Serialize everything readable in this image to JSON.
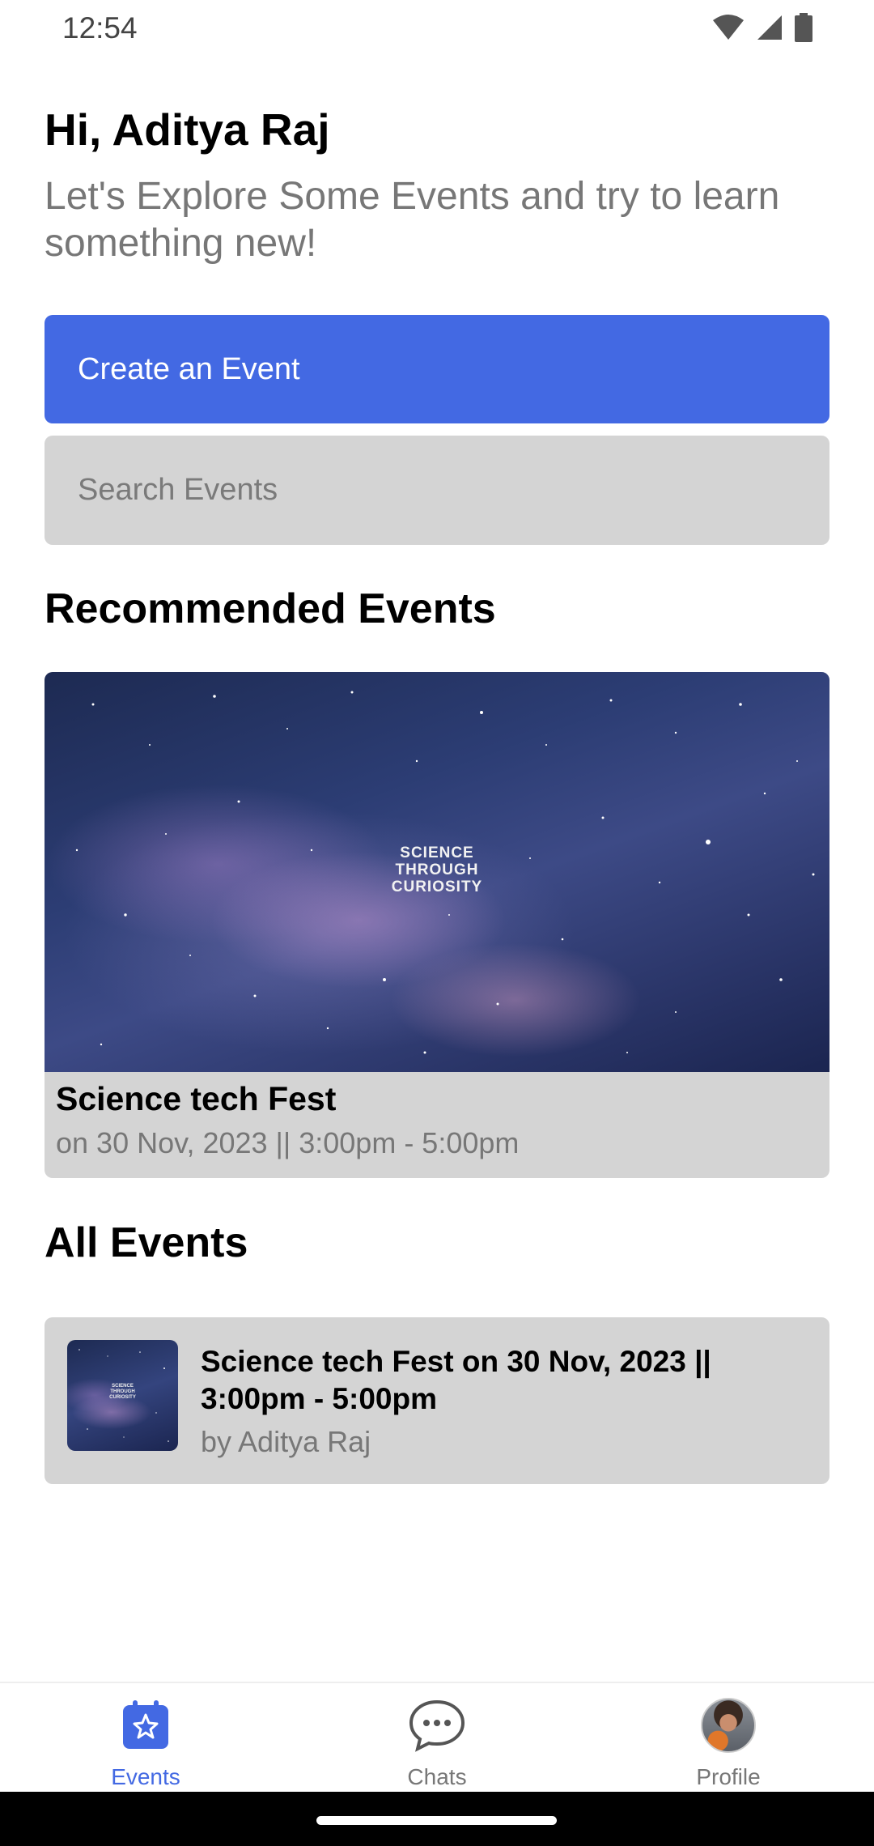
{
  "status_bar": {
    "time": "12:54",
    "icons": [
      "wifi-icon",
      "cellular-signal-icon",
      "battery-icon"
    ]
  },
  "header": {
    "greeting": "Hi, Aditya Raj",
    "subtitle": "Let's Explore Some Events and try to learn something new!"
  },
  "actions": {
    "create_label": "Create an Event",
    "search_placeholder": "Search Events"
  },
  "recommended": {
    "section_title": "Recommended Events",
    "card": {
      "image_text": "SCIENCE THROUGH CURIOSITY",
      "title": "Science tech Fest",
      "date": "on 30 Nov, 2023 || 3:00pm - 5:00pm"
    }
  },
  "all_events": {
    "section_title": "All Events",
    "items": [
      {
        "thumb_text": "SCIENCE THROUGH CURIOSITY",
        "title": "Science tech Fest  on 30 Nov, 2023 || 3:00pm - 5:00pm",
        "author": "by Aditya Raj"
      }
    ]
  },
  "bottom_nav": {
    "items": [
      {
        "label": "Events",
        "icon": "events-star-icon",
        "active": true
      },
      {
        "label": "Chats",
        "icon": "chat-bubble-icon",
        "active": false
      },
      {
        "label": "Profile",
        "icon": "profile-avatar",
        "active": false
      }
    ]
  },
  "colors": {
    "accent": "#4369e3",
    "card_background": "#d4d4d4",
    "muted_text": "#777777"
  }
}
